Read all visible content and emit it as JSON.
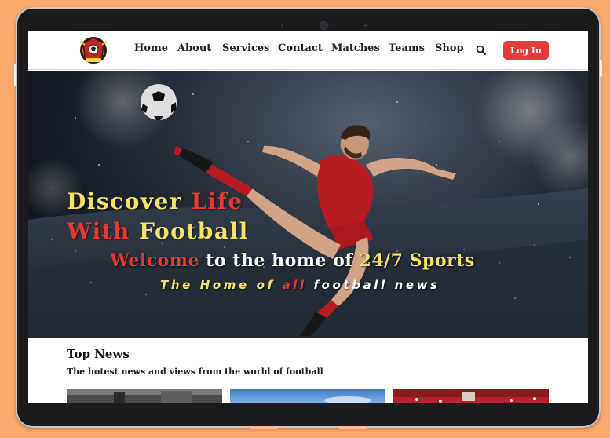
{
  "nav": {
    "items": [
      "Home",
      "About",
      "Services",
      "Contact",
      "Matches",
      "Teams",
      "Shop"
    ],
    "login": "Log In"
  },
  "hero": {
    "line1": {
      "w1": "Discover",
      "w2": "Life"
    },
    "line2": {
      "w1": "With",
      "w2": "Football"
    },
    "welcome": {
      "w1": "Welcome",
      "w2": "to the home of",
      "w3": "24/7 Sports"
    },
    "tagline": {
      "w1": "The Home of",
      "w2": "all",
      "w3": "football news"
    }
  },
  "top_news": {
    "title": "Top News",
    "subtitle": "The hotest news and views from the world of football"
  },
  "colors": {
    "accent_red": "#e63b3b",
    "headline_yellow": "#f4e26a",
    "page_background": "#f9a96b"
  },
  "icons": [
    "search-icon",
    "club-logo",
    "soccer-ball"
  ]
}
